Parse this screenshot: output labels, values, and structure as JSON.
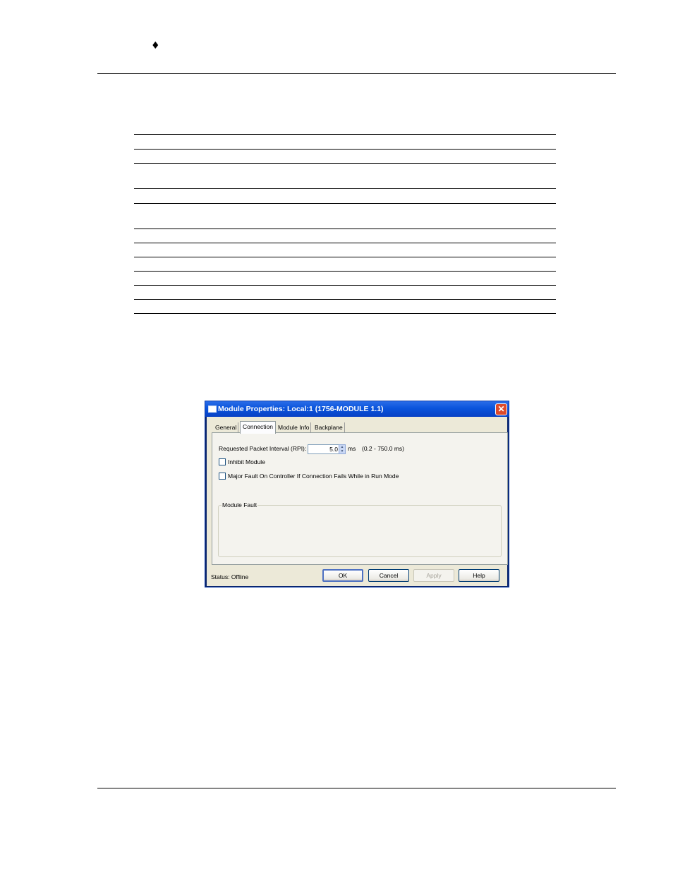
{
  "page": {
    "bullet": "♦"
  },
  "dialog": {
    "title": "Module Properties: Local:1 (1756-MODULE 1.1)",
    "close_glyph": "✕",
    "tabs": [
      "General",
      "Connection",
      "Module Info",
      "Backplane"
    ],
    "active_tab": "Connection",
    "rpi_label": "Requested Packet Interval (RPI):",
    "rpi_value": "5.0",
    "rpi_unit": "ms",
    "rpi_range": "(0.2 - 750.0 ms)",
    "inhibit_label": "Inhibit Module",
    "inhibit_checked": false,
    "major_fault_label": "Major Fault On Controller If Connection Fails While in Run Mode",
    "major_fault_checked": false,
    "module_fault_title": "Module Fault",
    "status": "Status:  Offline",
    "buttons": {
      "ok": "OK",
      "cancel": "Cancel",
      "apply": "Apply",
      "help": "Help"
    }
  }
}
